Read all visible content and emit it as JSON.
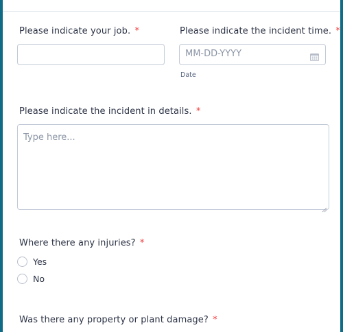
{
  "form": {
    "required_marker": "*",
    "job": {
      "label": "Please indicate your job.",
      "value": ""
    },
    "incident_time": {
      "label": "Please indicate the incident time.",
      "placeholder": "MM-DD-YYYY",
      "sublabel": "Date",
      "icon": "calendar-icon"
    },
    "details": {
      "label": "Please indicate the incident in details.",
      "placeholder": "Type here..."
    },
    "injuries": {
      "label": "Where there any injuries?",
      "options": [
        "Yes",
        "No"
      ]
    },
    "damage": {
      "label": "Was there any property or plant damage?"
    }
  },
  "colors": {
    "frame": "#0f6b86",
    "required": "#f23a3c",
    "border": "#c3cad8"
  }
}
